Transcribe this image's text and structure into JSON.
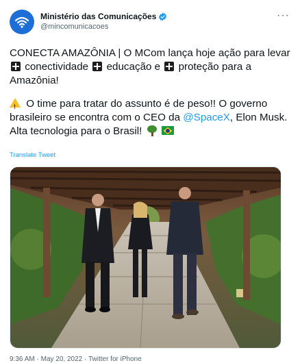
{
  "account": {
    "display_name": "Ministério das Comunicações",
    "handle": "@mincomunicacoes"
  },
  "more_label": "···",
  "tweet": {
    "line1_prefix": "CONECTA AMAZÔNIA | O MCom lança hoje ação para levar",
    "word_connectivity": "conectividade",
    "word_education": "educação e",
    "word_protection": "proteção",
    "line1_suffix": "para a Amazônia!",
    "para2_start": "O time para tratar do assunto é de peso!! O governo brasileiro se encontra com o CEO da",
    "mention": "@SpaceX",
    "para2_end": ", Elon Musk. Alta tecnologia para o Brasil!"
  },
  "translate_label": "Translate Tweet",
  "meta": {
    "time": "9:36 AM",
    "separator": "·",
    "date": "May 20, 2022",
    "source": "Twitter for iPhone"
  },
  "colors": {
    "brand": "#1d6fd8",
    "link": "#1d9bf0",
    "secondary_text": "#536471"
  },
  "icons": [
    "wifi-logo-icon",
    "verified-badge-icon",
    "more-icon",
    "plus-icon",
    "warning-icon",
    "tree-icon",
    "brazil-flag-icon"
  ]
}
